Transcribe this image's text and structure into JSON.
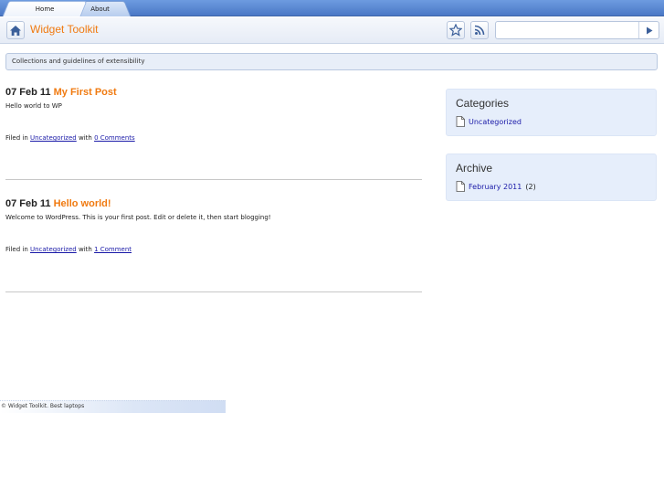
{
  "tabs": [
    {
      "label": "Home",
      "active": true
    },
    {
      "label": "About",
      "active": false
    }
  ],
  "header": {
    "site_title": "Widget Toolkit",
    "search": {
      "value": "",
      "placeholder": ""
    }
  },
  "description": "Collections and guidelines of extensibility",
  "posts": [
    {
      "date": "07 Feb 11",
      "title": "My First Post",
      "excerpt": "Hello world to WP",
      "filed_prefix": "Filed in",
      "category": "Uncategorized",
      "with_word": "with",
      "comments": "0 Comments"
    },
    {
      "date": "07 Feb 11",
      "title": "Hello world!",
      "excerpt": "Welcome to WordPress. This is your first post. Edit or delete it, then start blogging!",
      "filed_prefix": "Filed in",
      "category": "Uncategorized",
      "with_word": "with",
      "comments": "1 Comment"
    }
  ],
  "sidebar": {
    "categories": {
      "title": "Categories",
      "items": [
        {
          "label": "Uncategorized"
        }
      ]
    },
    "archive": {
      "title": "Archive",
      "items": [
        {
          "label": "February 2011",
          "count": "(2)"
        }
      ]
    }
  },
  "footer": {
    "text": "© Widget Toolkit. Best laptops"
  },
  "colors": {
    "accent": "#f07a10",
    "link": "#1a1aa8",
    "tabbar": "#4a78c6"
  },
  "icons": [
    "home-icon",
    "star-icon",
    "rss-icon",
    "arrow-right-icon",
    "page-icon"
  ]
}
